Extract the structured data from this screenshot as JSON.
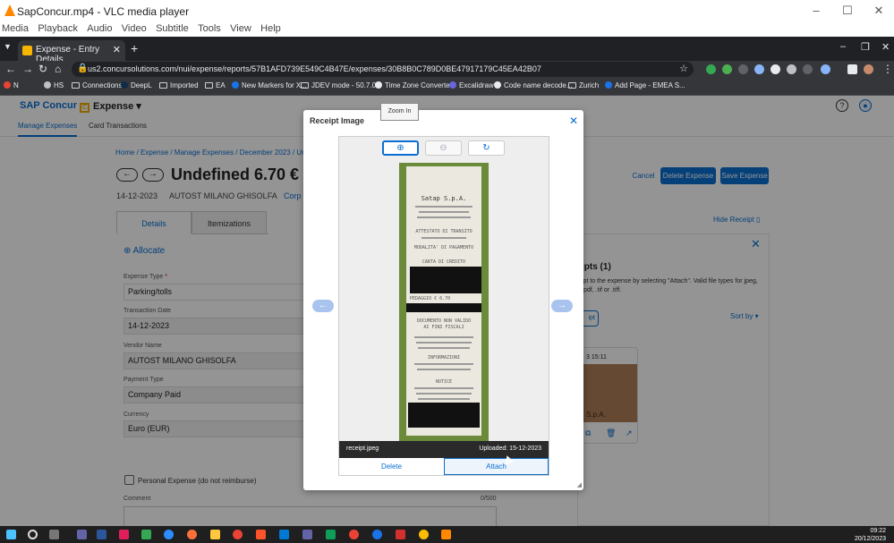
{
  "vlc": {
    "title": "SapConcur.mp4 - VLC media player",
    "menu": [
      "Media",
      "Playback",
      "Audio",
      "Video",
      "Subtitle",
      "Tools",
      "View",
      "Help"
    ]
  },
  "browser": {
    "tab_title": "Expense - Entry Details",
    "url": "us2.concursolutions.com/nui/expense/reports/57B1AFD739E549C4B47E/expenses/30B8B0C789D0BE47917179C45EA42B07",
    "bookmarks": [
      "N",
      "HS",
      "Connections",
      "DeepL",
      "Imported",
      "EA",
      "New Markers for X...",
      "JDEV mode - 50.7.0...",
      "Time Zone Converte...",
      "Excalidraw",
      "Code name decode...",
      "Zurich",
      "Add Page - EMEA S..."
    ]
  },
  "app": {
    "brand": "SAP Concur",
    "brand_mark": "C",
    "module": "Expense",
    "subnav": [
      "Manage Expenses",
      "Card Transactions"
    ]
  },
  "entry": {
    "breadcrumb": "Home / Expense / Manage Expenses / December 2023 / Undefine",
    "title": "Undefined 6.70 €",
    "date": "14-12-2023",
    "vendor": "AUTOST MILANO GHISOLFA",
    "corp": "Corp"
  },
  "actions": {
    "cancel": "Cancel",
    "delete": "Delete Expense",
    "save": "Save Expense",
    "hide_receipt": "Hide Receipt"
  },
  "tabs": [
    "Details",
    "Itemizations"
  ],
  "form": {
    "allocate": "Allocate",
    "expense_type_label": "Expense Type",
    "expense_type_value": "Parking/tolls",
    "transaction_date_label": "Transaction Date",
    "transaction_date_value": "14-12-2023",
    "vendor_name_label": "Vendor Name",
    "vendor_name_value": "AUTOST MILANO GHISOLFA",
    "payment_type_label": "Payment Type",
    "payment_type_value": "Company Paid",
    "currency_label": "Currency",
    "currency_value": "Euro (EUR)",
    "personal_expense_label": "Personal Expense (do not reimburse)",
    "comment_label": "Comment",
    "comment_count": "0/500"
  },
  "receipt_panel": {
    "title": "ipts (1)",
    "description": "ipt to the expense by selecting \"Attach\". Valid file types for jpeg, .pdf, .tif or .tiff.",
    "button": "ipt",
    "sort": "Sort by",
    "date": "3 15:11",
    "thumb_text": "S.p.A."
  },
  "modal": {
    "title": "Receipt Image",
    "tooltip": "Zoom In",
    "filename": "receipt.jpeg",
    "uploaded": "Uploaded: 15-12-2023",
    "delete": "Delete",
    "attach": "Attach"
  },
  "receipt_lines": [
    "Satap S.p.A.",
    "ATTESTATO DI TRANSITO",
    "MODALITA' DI PAGAMENTO",
    "CARTA DI CREDITO",
    "PEDAGGIO € 6.70",
    "DOCUMENTO NON VALIDO",
    "AI FINI FISCALI",
    "INFORMAZIONI",
    "NOTICE"
  ],
  "taskbar": {
    "time": "09:22",
    "date": "20/12/2023"
  },
  "colors": {
    "accent": "#0a6ed1",
    "chrome_dark": "#202124",
    "overlay": "#000000"
  }
}
